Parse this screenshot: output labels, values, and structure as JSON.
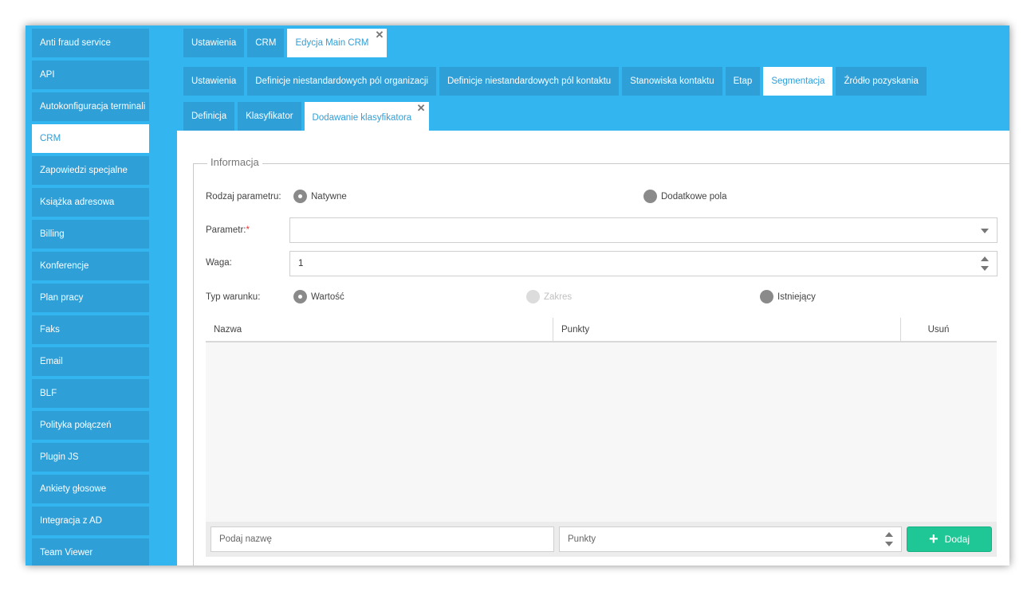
{
  "sidebar": {
    "items": [
      {
        "label": "Anti fraud service"
      },
      {
        "label": "API"
      },
      {
        "label": "Autokonfiguracja terminali"
      },
      {
        "label": "CRM",
        "active": true
      },
      {
        "label": "Zapowiedzi specjalne"
      },
      {
        "label": "Książka adresowa"
      },
      {
        "label": "Billing"
      },
      {
        "label": "Konferencje"
      },
      {
        "label": "Plan pracy"
      },
      {
        "label": "Faks"
      },
      {
        "label": "Email"
      },
      {
        "label": "BLF"
      },
      {
        "label": "Polityka połączeń"
      },
      {
        "label": "Plugin JS"
      },
      {
        "label": "Ankiety głosowe"
      },
      {
        "label": "Integracja z AD"
      },
      {
        "label": "Team Viewer"
      }
    ]
  },
  "tabs_level1": [
    "Ustawienia",
    "CRM",
    "Edycja Main CRM"
  ],
  "tabs_level2": [
    "Ustawienia",
    "Definicje niestandardowych pól organizacji",
    "Definicje niestandardowych pól kontaktu",
    "Stanowiska kontaktu",
    "Etap",
    "Segmentacja",
    "Źródło pozyskania"
  ],
  "tabs_level3": [
    "Definicja",
    "Klasyfikator",
    "Dodawanie klasyfikatora"
  ],
  "close_glyph": "✕",
  "form": {
    "legend": "Informacja",
    "param_type_label": "Rodzaj parametru:",
    "param_type_options": [
      "Natywne",
      "Dodatkowe pola"
    ],
    "param_label": "Parametr:",
    "required_mark": "*",
    "param_value": "",
    "weight_label": "Waga:",
    "weight_value": "1",
    "condition_label": "Typ warunku:",
    "condition_options": [
      "Wartość",
      "Zakres",
      "Istniejący"
    ]
  },
  "table": {
    "columns": [
      "Nazwa",
      "Punkty",
      "Usuń"
    ],
    "rows": [],
    "name_placeholder": "Podaj nazwę",
    "points_placeholder": "Punkty",
    "add_label": "Dodaj",
    "add_icon": "plus-icon"
  },
  "colors": {
    "accent": "#33b5f0",
    "tab": "#2f9fd8",
    "add_button": "#1ec795"
  }
}
